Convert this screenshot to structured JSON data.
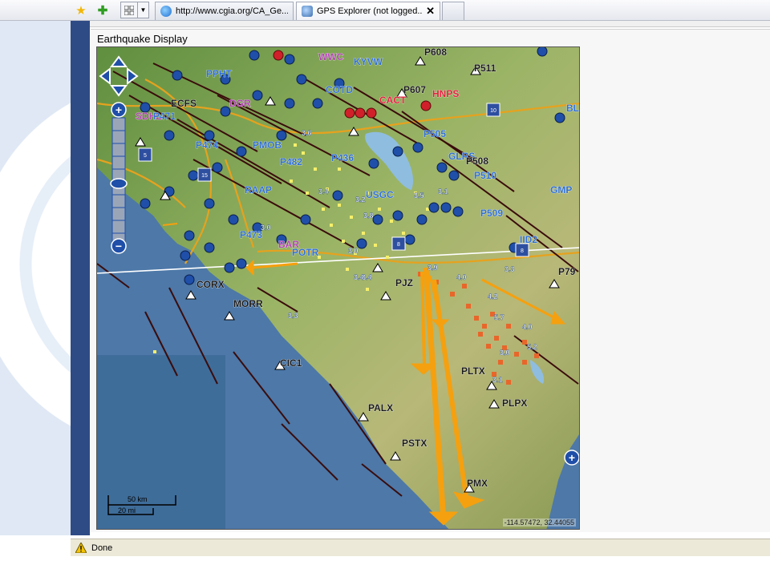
{
  "browser": {
    "tabs": [
      {
        "label": "http://www.cgia.org/CA_Ge..."
      },
      {
        "label": "GPS Explorer (not logged...",
        "close": "✕"
      }
    ]
  },
  "panel": {
    "title": "Earthquake Display"
  },
  "map": {
    "coordinate_readout": "-114.57472, 32.44055",
    "scale": {
      "km": "50 km",
      "mi": "20 mi"
    },
    "station_labels": [
      {
        "text": "P608",
        "color": "#1a1a1a"
      },
      {
        "text": "P511",
        "color": "#1a1a1a"
      },
      {
        "text": "P607",
        "color": "#1a1a1a"
      },
      {
        "text": "WWC",
        "color": "#b040b0"
      },
      {
        "text": "KYVW",
        "color": "#2f6fd0"
      },
      {
        "text": "PPHT",
        "color": "#2f6fd0"
      },
      {
        "text": "COTD",
        "color": "#2f6fd0"
      },
      {
        "text": "CACT",
        "color": "#e0203a"
      },
      {
        "text": "HNPS",
        "color": "#e0203a"
      },
      {
        "text": "ECFS",
        "color": "#1a1a1a"
      },
      {
        "text": "DGR",
        "color": "#b040b0"
      },
      {
        "text": "SDHL",
        "color": "#b040b0"
      },
      {
        "text": "P471",
        "color": "#2f6fd0"
      },
      {
        "text": "BL",
        "color": "#2f6fd0"
      },
      {
        "text": "P505",
        "color": "#2f6fd0"
      },
      {
        "text": "P474",
        "color": "#2f6fd0"
      },
      {
        "text": "PMOB",
        "color": "#2f6fd0"
      },
      {
        "text": "P436",
        "color": "#2f6fd0"
      },
      {
        "text": "GLRS",
        "color": "#2f6fd0"
      },
      {
        "text": "P508",
        "color": "#1a1a1a"
      },
      {
        "text": "P482",
        "color": "#2f6fd0"
      },
      {
        "text": "P510",
        "color": "#2f6fd0"
      },
      {
        "text": "RAAP",
        "color": "#2f6fd0"
      },
      {
        "text": "USGC",
        "color": "#2f6fd0"
      },
      {
        "text": "GMP",
        "color": "#2f6fd0"
      },
      {
        "text": "P509",
        "color": "#2f6fd0"
      },
      {
        "text": "P473",
        "color": "#2f6fd0"
      },
      {
        "text": "BAR",
        "color": "#b040b0"
      },
      {
        "text": "IID2",
        "color": "#2f6fd0"
      },
      {
        "text": "POTR",
        "color": "#2f6fd0"
      },
      {
        "text": "P79",
        "color": "#1a1a1a"
      },
      {
        "text": "CORX",
        "color": "#1a1a1a"
      },
      {
        "text": "PJZ",
        "color": "#1a1a1a"
      },
      {
        "text": "MORR",
        "color": "#1a1a1a"
      },
      {
        "text": "CIC1",
        "color": "#1a1a1a"
      },
      {
        "text": "PLTX",
        "color": "#1a1a1a"
      },
      {
        "text": "PLPX",
        "color": "#1a1a1a"
      },
      {
        "text": "PALX",
        "color": "#1a1a1a"
      },
      {
        "text": "PSTX",
        "color": "#1a1a1a"
      },
      {
        "text": "PMX",
        "color": "#1a1a1a"
      }
    ],
    "magnitude_labels": [
      "3.6",
      "3.4",
      "3.5",
      "3.2",
      "3.3",
      "3.8",
      "3.0",
      "3.4",
      "3.1",
      "4.0",
      "4.2",
      "5.7",
      "4.0",
      "3.9",
      "5.2",
      "3.0",
      "3.1",
      "3.3",
      "3.0",
      "3.4"
    ],
    "highway_shields": [
      "10",
      "5",
      "15",
      "8",
      "8"
    ],
    "colors": {
      "land": "#8aa85a",
      "ocean": "#4d78a8",
      "lake": "#8fbde0",
      "station": "#1f4fa8",
      "station_alert": "#d0202a",
      "vector": "#f5a00f",
      "fault": "#3a0c0c",
      "highway": "#e6a21e",
      "quake_small": "#f6ef6a",
      "quake_large": "#e8662a"
    },
    "controls": {
      "zoom_in": "+",
      "zoom_out": "−",
      "expand": "+"
    }
  },
  "status": {
    "text": "Done"
  }
}
